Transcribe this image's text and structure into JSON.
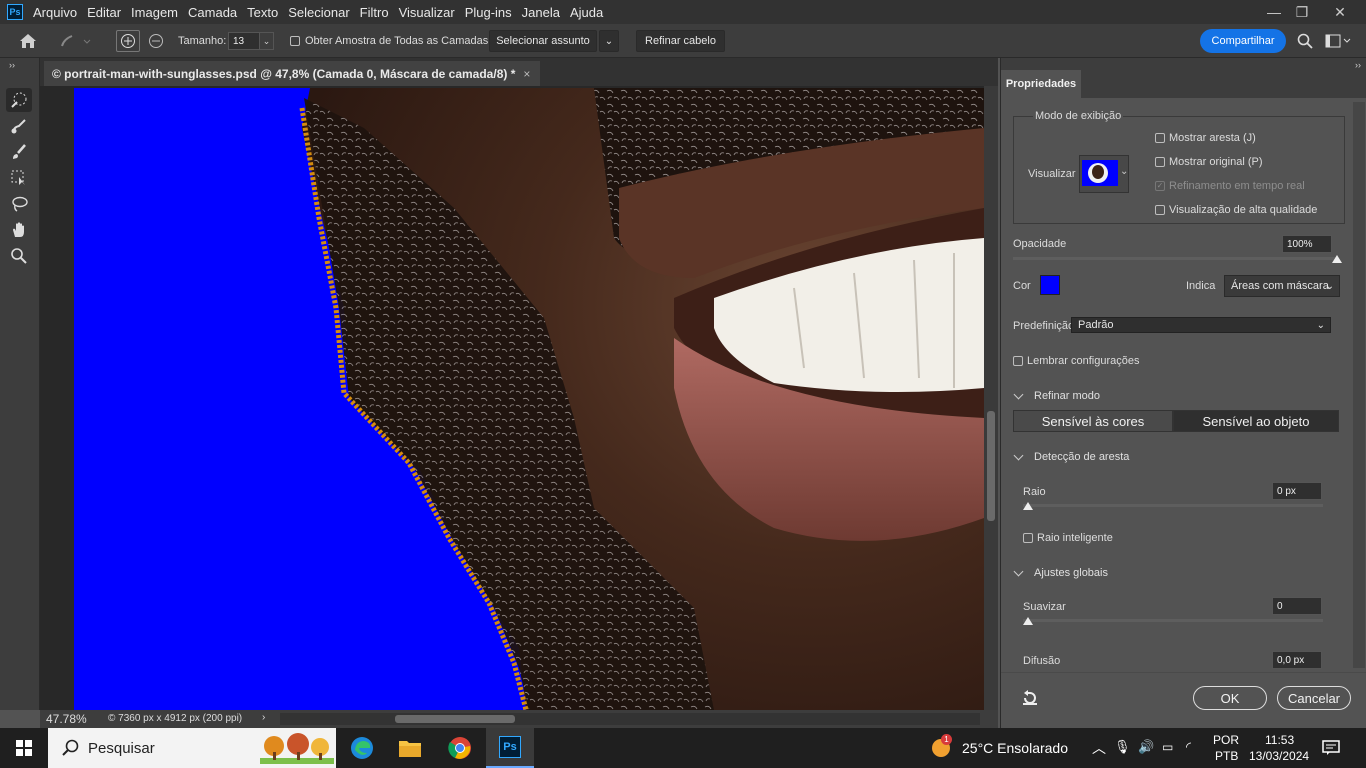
{
  "menubar": {
    "logo": "Ps",
    "items": [
      "Arquivo",
      "Editar",
      "Imagem",
      "Camada",
      "Texto",
      "Selecionar",
      "Filtro",
      "Visualizar",
      "Plug-ins",
      "Janela",
      "Ajuda"
    ]
  },
  "options": {
    "size_label": "Tamanho:",
    "size_value": "13",
    "sample_all_label": "Obter Amostra de Todas as Camadas",
    "select_subject": "Selecionar assunto",
    "refine_hair": "Refinar cabelo",
    "share": "Compartilhar"
  },
  "document": {
    "tab_title": "© portrait-man-with-sunglasses.psd @ 47,8% (Camada 0, Máscara de camada/8) *",
    "overlay_color": "#0000ff"
  },
  "status": {
    "zoom": "47.78%",
    "info": "© 7360 px x 4912 px (200 ppi)"
  },
  "properties": {
    "tab": "Propriedades",
    "view_mode_title": "Modo de exibição",
    "view_label": "Visualizar",
    "show_edge": "Mostrar aresta (J)",
    "show_original": "Mostrar original (P)",
    "realtime": "Refinamento em tempo real",
    "high_quality": "Visualização de alta qualidade",
    "opacity_label": "Opacidade",
    "opacity_value": "100%",
    "opacity_level": 1.0,
    "color_label": "Cor",
    "color_value": "#0000ff",
    "indicates_label": "Indica",
    "indicates_value": "Áreas com máscara",
    "preset_label": "Predefinição",
    "preset_value": "Padrão",
    "remember": "Lembrar configurações",
    "refine_mode": "Refinar modo",
    "color_aware": "Sensível às cores",
    "object_aware": "Sensível ao objeto",
    "edge_detection": "Detecção de aresta",
    "radius_label": "Raio",
    "radius_value": "0 px",
    "smart_radius": "Raio inteligente",
    "global": "Ajustes globais",
    "smooth_label": "Suavizar",
    "smooth_value": "0",
    "feather_label": "Difusão",
    "feather_value": "0,0 px",
    "ok": "OK",
    "cancel": "Cancelar"
  },
  "taskbar": {
    "search": "Pesquisar",
    "weather": "25°C  Ensolarado",
    "lang1": "POR",
    "lang2": "PTB",
    "time": "11:53",
    "date": "13/03/2024",
    "notif": "1"
  }
}
